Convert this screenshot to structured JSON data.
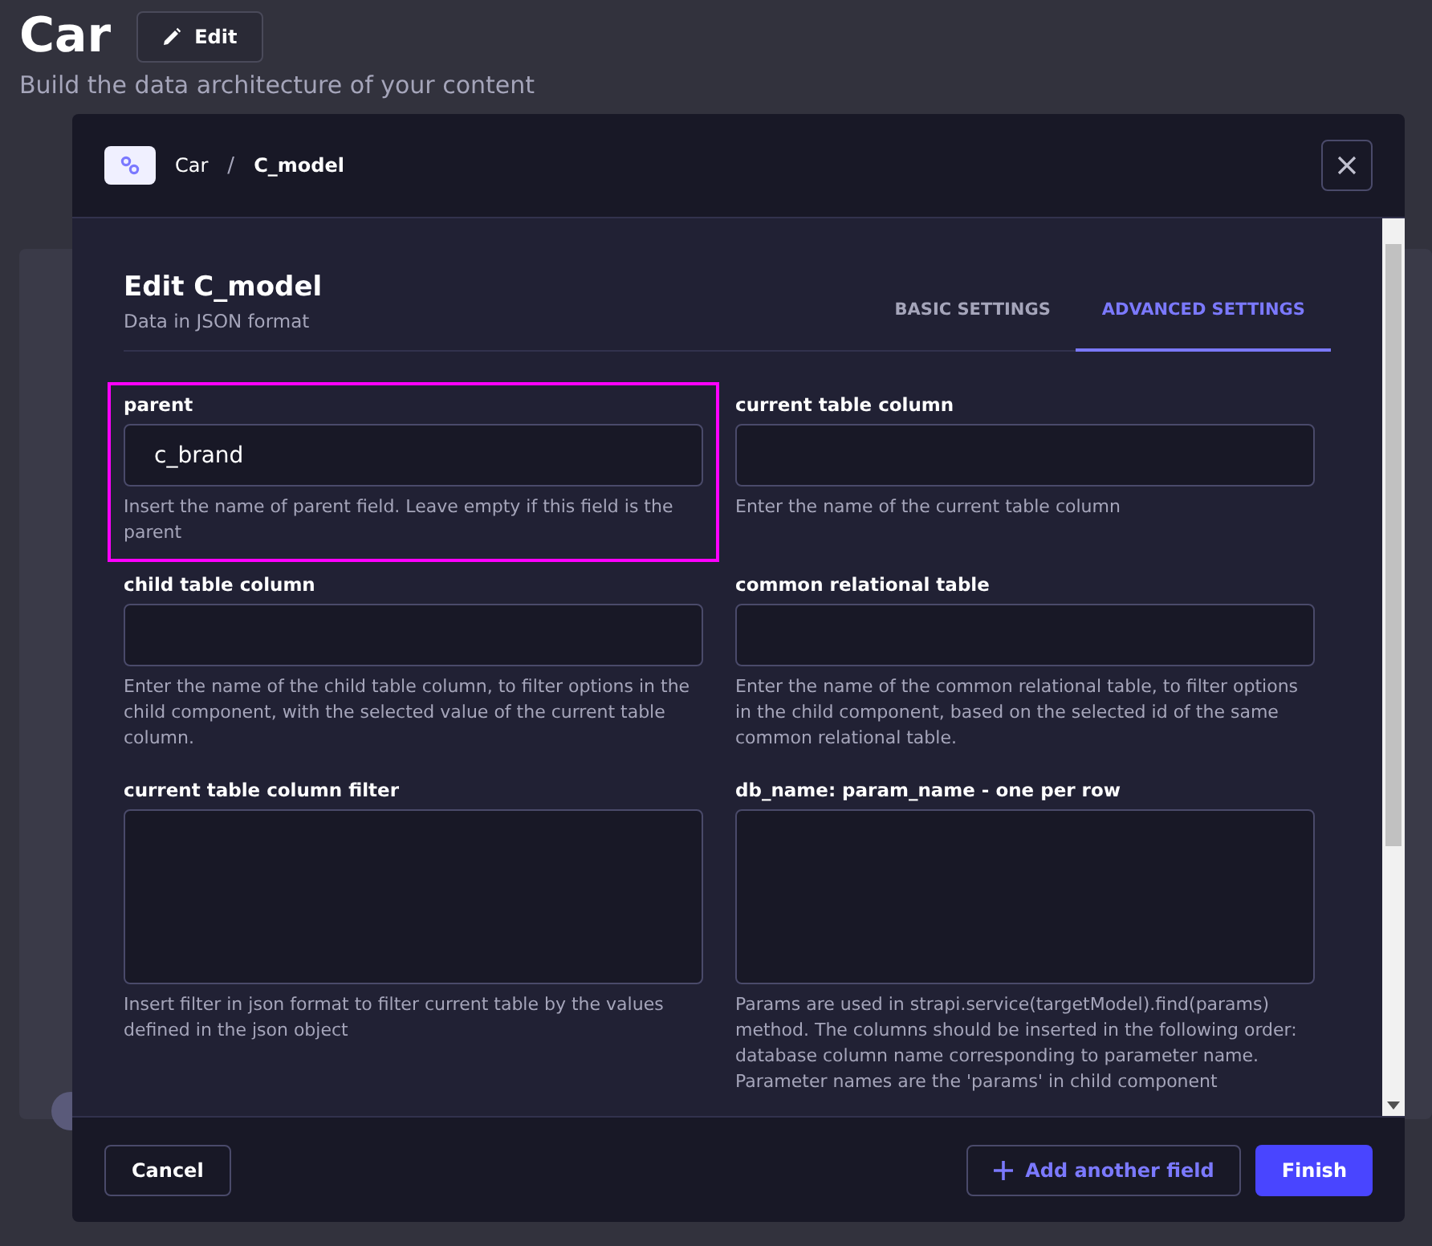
{
  "page": {
    "title": "Car",
    "edit_button": "Edit",
    "subtitle": "Build the data architecture of your content"
  },
  "modal": {
    "breadcrumb": [
      "Car",
      "C_model"
    ],
    "breadcrumb_separator": "/",
    "title": "Edit C_model",
    "subtitle": "Data in JSON format",
    "tabs": [
      {
        "label": "BASIC SETTINGS",
        "selected": false
      },
      {
        "label": "ADVANCED SETTINGS",
        "selected": true
      }
    ],
    "fields": [
      {
        "label": "parent",
        "kind": "input",
        "value": "c_brand",
        "hint": "Insert the name of parent field. Leave empty if this field is the parent",
        "highlighted": true
      },
      {
        "label": "current table column",
        "kind": "input",
        "hint": "Enter the name of the current table column",
        "highlighted": false
      },
      {
        "label": "child table column",
        "kind": "input",
        "hint": "Enter the name of the child table column, to filter options in the child component, with the selected value of the current table column.",
        "highlighted": false
      },
      {
        "label": "common relational table",
        "kind": "input",
        "hint": "Enter the name of the common relational table, to filter options in the child component, based on the selected id of the same common relational table.",
        "highlighted": false
      },
      {
        "label": "current table column filter",
        "kind": "textarea",
        "hint": "Insert filter in json format to filter current table by the values defined in the json object",
        "highlighted": false
      },
      {
        "label": "db_name: param_name - one per row",
        "kind": "textarea",
        "hint": "Params are used in strapi.service(targetModel).find(params) method. The columns should be inserted in the following order: database column name corresponding to parameter name. Parameter names are the 'params' in child component",
        "highlighted": false
      }
    ],
    "footer": {
      "cancel": "Cancel",
      "add": "Add another field",
      "finish": "Finish"
    }
  }
}
